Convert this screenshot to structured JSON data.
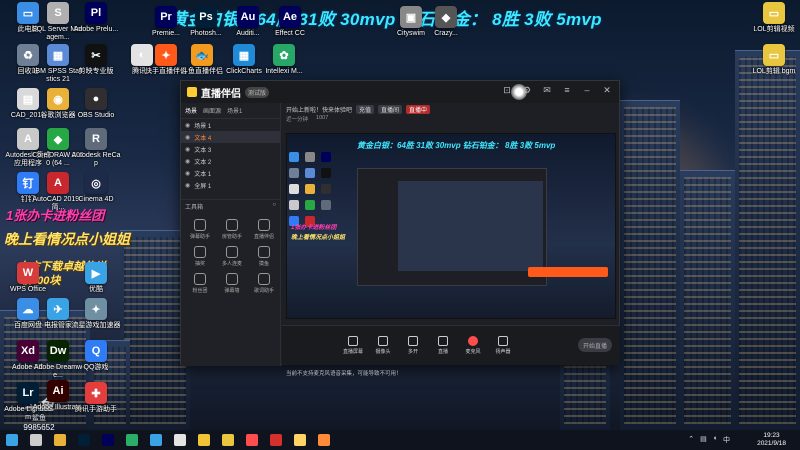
{
  "banner": "黄金白银：64胜 31败 30mvp 钻石铂金： 8胜 3败 5mvp",
  "promos": [
    "1张办卡进粉丝团",
    "晚上看情况点小姐姐",
    "右方下载卓越传说",
    "领500块"
  ],
  "desktop_icons_left": [
    {
      "label": "此电脑",
      "color": "#3a8ee6",
      "glyph": "▭"
    },
    {
      "label": "回收站",
      "color": "#6f7f95",
      "glyph": "♻"
    },
    {
      "label": "CAD_2019",
      "color": "#d9d9d9",
      "glyph": "▤"
    },
    {
      "label": "Autodesk 集成 应用程序",
      "color": "#c9c9c9",
      "glyph": "A"
    },
    {
      "label": "钉钉",
      "color": "#2f7cf6",
      "glyph": "钉"
    },
    {
      "label": "WPS Office",
      "color": "#d63c3c",
      "glyph": "W"
    },
    {
      "label": "百度网盘",
      "color": "#3a8ee6",
      "glyph": "☁"
    },
    {
      "label": "Adobe XD",
      "color": "#470137",
      "glyph": "Xd"
    },
    {
      "label": "Adobe Lightroom",
      "color": "#001e36",
      "glyph": "Lr"
    }
  ],
  "desktop_icons_col2": [
    {
      "label": "SQL Server Managem...",
      "color": "#b0b0b0",
      "glyph": "S"
    },
    {
      "label": "IBM SPSS Statistics 21",
      "color": "#5b8bd6",
      "glyph": "▦"
    },
    {
      "label": "谷歌浏览器",
      "color": "#e8b13a",
      "glyph": "◉"
    },
    {
      "label": "CorelDRAW 2020 (64 ...",
      "color": "#27a844",
      "glyph": "◆"
    },
    {
      "label": "AutoCAD 2019 - 简...",
      "color": "#c8272d",
      "glyph": "A"
    },
    {
      "label": "电报管家",
      "color": "#3aa3e6",
      "glyph": "✈"
    },
    {
      "label": "Adobe Dreamwe...",
      "color": "#072401",
      "glyph": "Dw"
    },
    {
      "label": "Adobe Illustrat...",
      "color": "#330000",
      "glyph": "Ai"
    }
  ],
  "desktop_icons_col3": [
    {
      "label": "Adobe Prelu...",
      "color": "#00005b",
      "glyph": "Pl"
    },
    {
      "label": "剪映专业版",
      "color": "#111111",
      "glyph": "✂"
    },
    {
      "label": "OBS Studio",
      "color": "#302e31",
      "glyph": "●"
    },
    {
      "label": "Autodesk ReCap",
      "color": "#5f6a7a",
      "glyph": "R"
    },
    {
      "label": "Cinema 4D",
      "color": "#1d2b48",
      "glyph": "◎"
    },
    {
      "label": "优酷",
      "color": "#3aa3e6",
      "glyph": "▶"
    },
    {
      "label": "流星游戏加速器",
      "color": "#6f8fa3",
      "glyph": "✦"
    },
    {
      "label": "QQ游戏",
      "color": "#2f7cf6",
      "glyph": "Q"
    },
    {
      "label": "腾讯手游助手",
      "color": "#e33e3e",
      "glyph": "✚"
    }
  ],
  "desktop_icons_top": [
    {
      "label": "Premie...",
      "color": "#00005b",
      "glyph": "Pr"
    },
    {
      "label": "Photosh...",
      "color": "#001e36",
      "glyph": "Ps"
    },
    {
      "label": "Auditi...",
      "color": "#00005b",
      "glyph": "Au"
    },
    {
      "label": "Effect CC",
      "color": "#00005b",
      "glyph": "Ae"
    },
    {
      "label": "快手直播伴侣",
      "color": "#ff5a1a",
      "glyph": "✦"
    },
    {
      "label": "斗鱼直播伴侣",
      "color": "#f29b1f",
      "glyph": "🐟"
    },
    {
      "label": "ClickCharts",
      "color": "#1f8bd6",
      "glyph": "▦"
    },
    {
      "label": "Intellexi M...",
      "color": "#28a866",
      "glyph": "✿"
    },
    {
      "label": "腾讯...",
      "color": "#e3e3e3",
      "glyph": "◐"
    },
    {
      "label": "Crazy...",
      "color": "#555",
      "glyph": "◆"
    },
    {
      "label": "Cityswim",
      "color": "#888",
      "glyph": "▣"
    }
  ],
  "desktop_icons_right": [
    {
      "label": "LOL剪辑视频",
      "color": "#e8c640",
      "glyph": "▭"
    },
    {
      "label": "LOL剪辑 bgm",
      "color": "#e8c640",
      "glyph": "▭"
    }
  ],
  "app": {
    "name": "直播伴侣",
    "badge": "测试版",
    "sidebar_tabs": [
      "场景",
      "画面源",
      "场景1"
    ],
    "scene_items": [
      "场景 1",
      "文本 4",
      "文本 3",
      "文本 2",
      "文本 1",
      "全屏 1"
    ],
    "tools_header": "工具箱",
    "tools": [
      "弹幕助手",
      "房管助手",
      "直播伴侣",
      "抽奖",
      "多人连麦",
      "摸鱼",
      "粉丝团",
      "弹幕墙",
      "歌词助手"
    ],
    "notice_text": "开始上新啦！快来体验吧",
    "notice_tags": [
      "充值",
      "直播间",
      "直播中"
    ],
    "stats": [
      "近一分钟",
      "1007"
    ],
    "preview_banner": "黄金白银：64胜 31败 30mvp 钻石铂金： 8胜 3败 5mvp",
    "preview_promo1": "1张办卡进粉丝团",
    "preview_promo2": "晚上看情况点小姐姐",
    "bottom_tools": [
      "直播屏幕",
      "摄像头",
      "多开",
      "直播",
      "麦克风",
      "扬声器"
    ],
    "start_button": "开始直播",
    "status_text": "当前不支持麦克风语音采集，可能导致不可用！"
  },
  "watermark": {
    "logo": "斗鱼",
    "sub": "鲨鱼",
    "id": "9985652"
  },
  "taskbar": {
    "apps": [
      {
        "name": "start-icon",
        "color": "#3aa3e6"
      },
      {
        "name": "search-icon",
        "color": "#cccccc"
      },
      {
        "name": "chrome-icon",
        "color": "#e8b13a"
      },
      {
        "name": "photoshop-icon",
        "color": "#001e36"
      },
      {
        "name": "premiere-icon",
        "color": "#00005b"
      },
      {
        "name": "wechat-icon",
        "color": "#2aae67"
      },
      {
        "name": "player-icon",
        "color": "#3aa3e6"
      },
      {
        "name": "app-icon",
        "color": "#e3e3e3"
      },
      {
        "name": "potplayer-icon",
        "color": "#f2c335"
      },
      {
        "name": "files-icon",
        "color": "#e8c640"
      },
      {
        "name": "game-icon",
        "color": "#ff4d4d"
      },
      {
        "name": "netease-icon",
        "color": "#d6302c"
      },
      {
        "name": "folder-icon",
        "color": "#ffd266"
      },
      {
        "name": "livestream-icon",
        "color": "#ff8a3a"
      }
    ],
    "tray_lang": "中",
    "time": "19:23",
    "date": "2021/9/18"
  }
}
